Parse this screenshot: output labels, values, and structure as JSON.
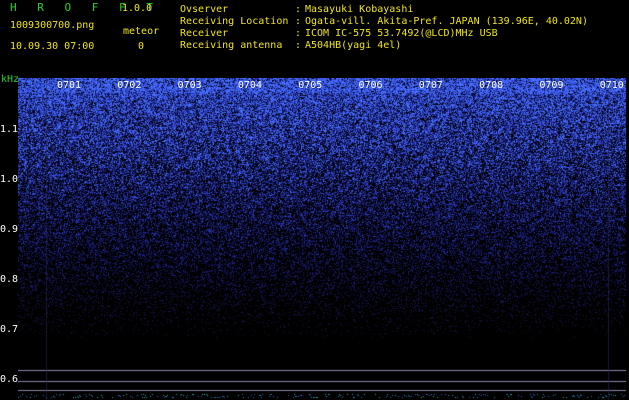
{
  "app": {
    "logo": "H R O F F T",
    "version": "1.0.0"
  },
  "capture": {
    "filename": "1009300700.png",
    "datetime": "10.09.30 07:00",
    "meteor_label": "meteor",
    "meteor_count": "0"
  },
  "info": {
    "rows": [
      {
        "label": "Ovserver",
        "sep": ":",
        "value": "Masayuki Kobayashi"
      },
      {
        "label": "Receiving Location",
        "sep": ":",
        "value": "Ogata-vill. Akita-Pref. JAPAN (139.96E, 40.02N)"
      },
      {
        "label": "Receiver",
        "sep": ":",
        "value": "ICOM IC-575 53.7492(@LCD)MHz USB"
      },
      {
        "label": "Receiving antenna",
        "sep": ":",
        "value": "A504HB(yagi 4el)"
      }
    ]
  },
  "chart_data": {
    "type": "heatmap",
    "ylabel": "kHz",
    "y_ticks": [
      "1.1",
      "1.0",
      "0.9",
      "0.8",
      "0.7",
      "0.6"
    ],
    "x_ticks": [
      "0701",
      "0702",
      "0703",
      "0704",
      "0705",
      "0706",
      "0707",
      "0708",
      "0709",
      "0710"
    ],
    "colors": {
      "noise_high": "#3c5cff",
      "noise_low": "#101a80",
      "background": "#000000",
      "axis_text": "#ffffff",
      "header_green": "#29d129",
      "header_yellow": "#f0e41e"
    }
  }
}
